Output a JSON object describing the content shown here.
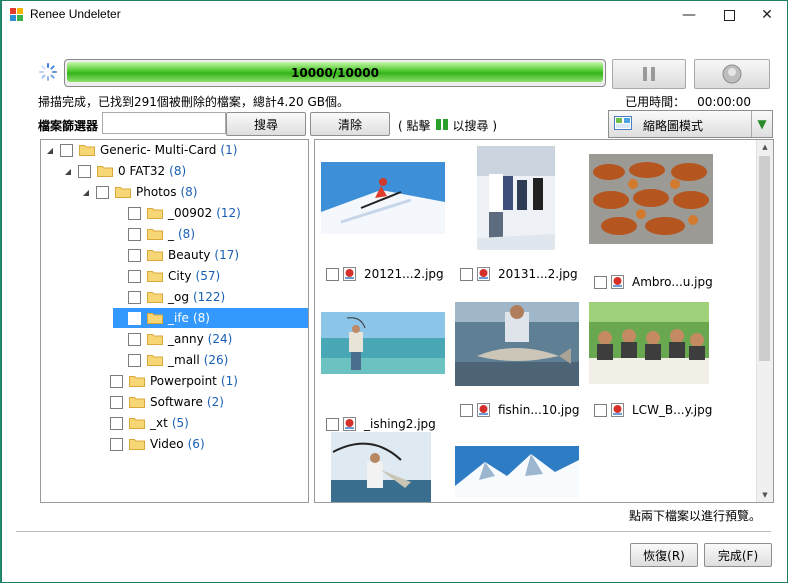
{
  "window": {
    "title": "Renee Undeleter"
  },
  "progress": {
    "text": "10000/10000",
    "fraction": 1.0
  },
  "status": {
    "message": "掃描完成，已找到291個被刪除的檔案，總計4.20 GB個。",
    "elapsed_label": "已用時間：",
    "elapsed_value": "00:00:00"
  },
  "filter": {
    "label": "檔案篩選器",
    "value": "",
    "search_button": "搜尋",
    "clear_button": "清除",
    "hint_before": "( 點擊",
    "hint_after": "以搜尋 )"
  },
  "view_mode": {
    "selected": "縮略圖模式"
  },
  "tree": {
    "root": {
      "label": "Generic- Multi-Card",
      "count": "(1)"
    },
    "drive": {
      "label": "0 FAT32",
      "count": "(8)"
    },
    "photos": {
      "label": "Photos",
      "count": "(8)"
    },
    "photo_folders": [
      {
        "label": "_00902",
        "count": "(12)"
      },
      {
        "label": "_",
        "count": "(8)"
      },
      {
        "label": "Beauty",
        "count": "(17)"
      },
      {
        "label": "City",
        "count": "(57)"
      },
      {
        "label": "_og",
        "count": "(122)"
      },
      {
        "label": "_ife",
        "count": "(8)"
      },
      {
        "label": "_anny",
        "count": "(24)"
      },
      {
        "label": "_mall",
        "count": "(26)"
      }
    ],
    "other_folders": [
      {
        "label": "Powerpoint",
        "count": "(1)"
      },
      {
        "label": "Software",
        "count": "(2)"
      },
      {
        "label": "_xt",
        "count": "(5)"
      },
      {
        "label": "Video",
        "count": "(6)"
      }
    ]
  },
  "files": [
    {
      "name": "20121...2.jpg",
      "image": "skier"
    },
    {
      "name": "20131...2.jpg",
      "image": "people-snow"
    },
    {
      "name": "Ambro...u.jpg",
      "image": "grilled-food"
    },
    {
      "name": "_ishing2.jpg",
      "image": "fishing-sea"
    },
    {
      "name": "fishin...10.jpg",
      "image": "man-with-fish"
    },
    {
      "name": "LCW_B...y.jpg",
      "image": "dinner-party"
    },
    {
      "name": "",
      "image": "fisherman"
    },
    {
      "name": "",
      "image": "mountains"
    }
  ],
  "footer": {
    "hint": "點兩下檔案以進行預覽。",
    "recover_button": "恢復(R)",
    "finish_button": "完成(F)"
  },
  "colors": {
    "accent": "#3399ff",
    "progress_green": "#34b21a",
    "frame": "#1f8a6e"
  }
}
